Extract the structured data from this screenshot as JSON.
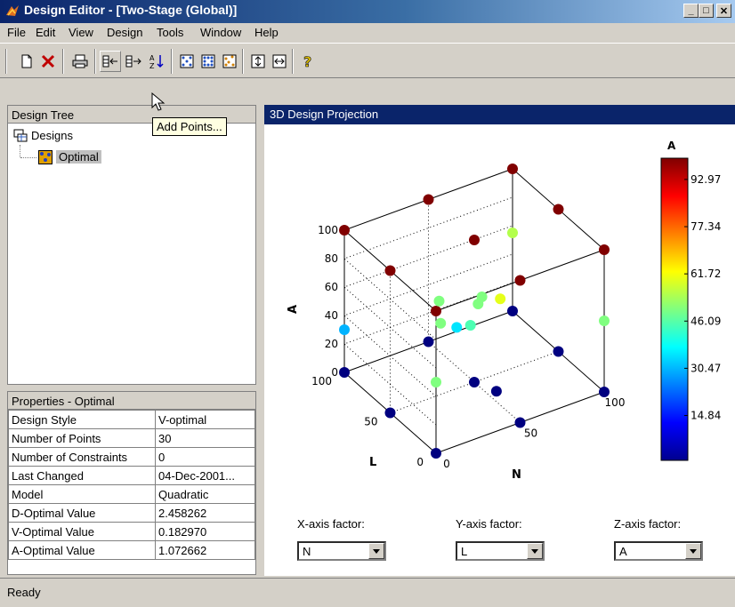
{
  "window": {
    "title": "Design Editor - [Two-Stage (Global)]",
    "min": "_",
    "max": "□",
    "close": "✕"
  },
  "menu": [
    "File",
    "Edit",
    "View",
    "Design",
    "Tools",
    "Window",
    "Help"
  ],
  "toolbar": {
    "icons": [
      "new-design-icon",
      "delete-icon",
      "print-icon",
      "add-points-icon",
      "delete-points-icon",
      "sort-icon",
      "design-style-1-icon",
      "design-style-2-icon",
      "design-style-3-icon",
      "stretch-vertical-icon",
      "stretch-horizontal-icon",
      "help-icon"
    ]
  },
  "tooltip": "Add Points...",
  "tree": {
    "header": "Design Tree",
    "root": "Designs",
    "child": "Optimal"
  },
  "properties": {
    "header": "Properties - Optimal",
    "rows": [
      {
        "key": "Design Style",
        "value": "V-optimal"
      },
      {
        "key": "Number of Points",
        "value": "30"
      },
      {
        "key": "Number of Constraints",
        "value": "0"
      },
      {
        "key": "Last Changed",
        "value": "04-Dec-2001..."
      },
      {
        "key": "Model",
        "value": "Quadratic"
      },
      {
        "key": "D-Optimal Value",
        "value": "2.458262"
      },
      {
        "key": "V-Optimal Value",
        "value": "0.182970"
      },
      {
        "key": "A-Optimal Value",
        "value": "1.072662"
      }
    ]
  },
  "projection": {
    "header": "3D Design Projection"
  },
  "chart_data": {
    "type": "scatter",
    "xlabel": "N",
    "ylabel": "L",
    "zlabel": "A",
    "xlim": [
      0,
      100
    ],
    "ylim": [
      0,
      100
    ],
    "zlim": [
      0,
      100
    ],
    "xticks": [
      "0",
      "50",
      "100"
    ],
    "yticks": [
      "0",
      "50",
      "100"
    ],
    "zticks": [
      "0",
      "20",
      "40",
      "60",
      "80",
      "100"
    ],
    "grid": true,
    "colorbar": {
      "title": "A",
      "ticks": [
        "92.97",
        "77.34",
        "61.72",
        "46.09",
        "30.47",
        "14.84"
      ]
    },
    "points": [
      {
        "x": 0,
        "y": 0,
        "z": 0
      },
      {
        "x": 100,
        "y": 0,
        "z": 0
      },
      {
        "x": 0,
        "y": 100,
        "z": 0
      },
      {
        "x": 100,
        "y": 100,
        "z": 0
      },
      {
        "x": 50,
        "y": 0,
        "z": 0
      },
      {
        "x": 0,
        "y": 50,
        "z": 0
      },
      {
        "x": 50,
        "y": 100,
        "z": 0
      },
      {
        "x": 100,
        "y": 50,
        "z": 0
      },
      {
        "x": 50,
        "y": 50,
        "z": 0
      },
      {
        "x": 55,
        "y": 35,
        "z": 0
      },
      {
        "x": 0,
        "y": 0,
        "z": 100
      },
      {
        "x": 100,
        "y": 0,
        "z": 100
      },
      {
        "x": 0,
        "y": 100,
        "z": 100
      },
      {
        "x": 100,
        "y": 100,
        "z": 100
      },
      {
        "x": 50,
        "y": 0,
        "z": 100
      },
      {
        "x": 0,
        "y": 50,
        "z": 100
      },
      {
        "x": 50,
        "y": 100,
        "z": 100
      },
      {
        "x": 100,
        "y": 50,
        "z": 100
      },
      {
        "x": 50,
        "y": 50,
        "z": 100
      },
      {
        "x": 0,
        "y": 100,
        "z": 30
      },
      {
        "x": 100,
        "y": 0,
        "z": 50
      },
      {
        "x": 100,
        "y": 100,
        "z": 55
      },
      {
        "x": 0,
        "y": 0,
        "z": 50
      },
      {
        "x": 30,
        "y": 50,
        "z": 50
      },
      {
        "x": 40,
        "y": 70,
        "z": 50
      },
      {
        "x": 60,
        "y": 60,
        "z": 50
      },
      {
        "x": 45,
        "y": 45,
        "z": 45
      },
      {
        "x": 55,
        "y": 55,
        "z": 50
      },
      {
        "x": 45,
        "y": 60,
        "z": 35
      },
      {
        "x": 60,
        "y": 40,
        "z": 60
      }
    ]
  },
  "axes": {
    "x_label": "X-axis factor:",
    "x_value": "N",
    "y_label": "Y-axis factor:",
    "y_value": "L",
    "z_label": "Z-axis factor:",
    "z_value": "A"
  },
  "status": "Ready",
  "colors": {
    "title_bar": "#0a246a",
    "panel": "#d4d0c8",
    "selection": "#c0c0c0"
  }
}
